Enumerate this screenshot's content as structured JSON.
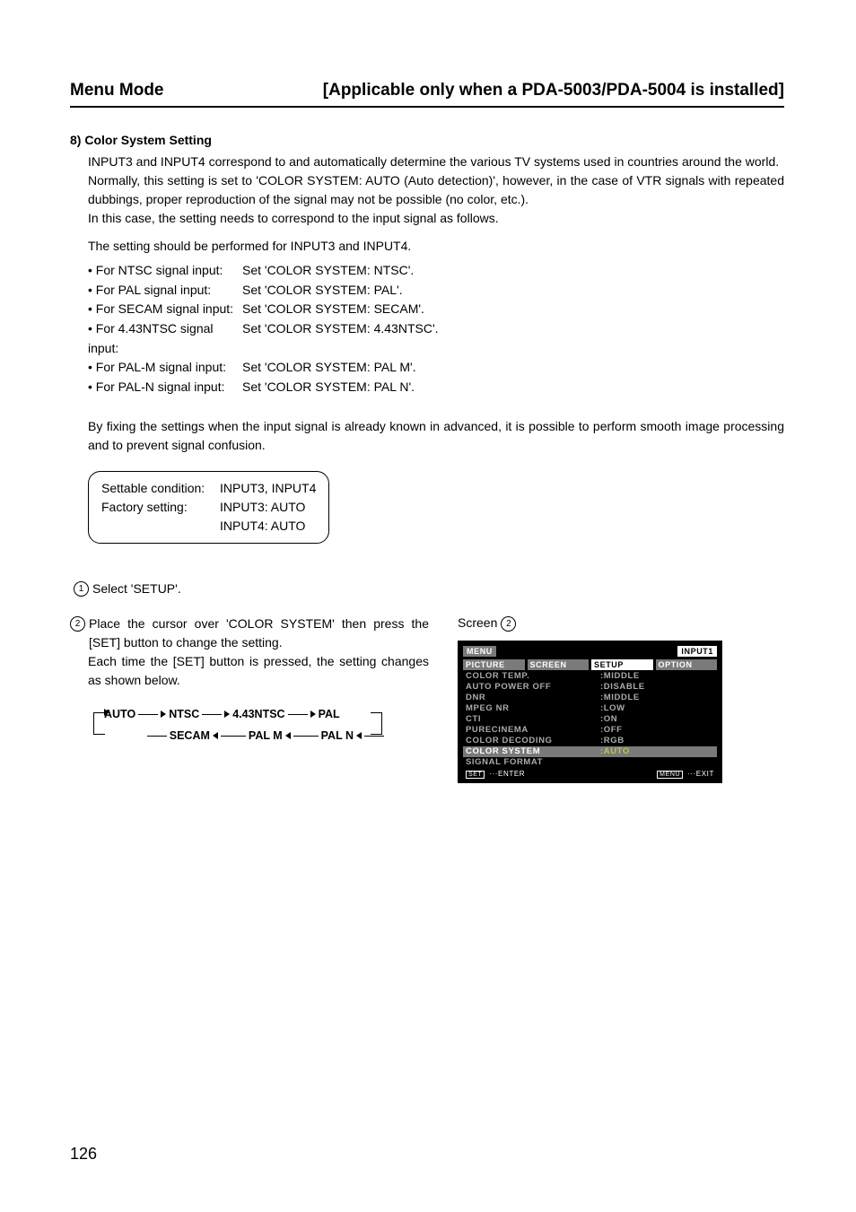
{
  "header": {
    "left": "Menu Mode",
    "right": "[Applicable only when a PDA-5003/PDA-5004 is installed]"
  },
  "section": {
    "title": "8) Color System Setting",
    "p1": "INPUT3 and INPUT4 correspond to and automatically determine the various TV systems used in countries around the world.",
    "p2": " Normally, this setting is set to 'COLOR SYSTEM: AUTO (Auto detection)', however, in the case of VTR signals with repeated dubbings, proper reproduction of the signal may not be possible (no color, etc.).",
    "p3": "In this case, the setting needs to correspond to the input signal as follows.",
    "p4": "The setting should be performed for INPUT3 and INPUT4.",
    "bullets": [
      {
        "label": "• For NTSC signal input:",
        "value": "Set 'COLOR SYSTEM: NTSC'."
      },
      {
        "label": "• For PAL signal input:",
        "value": "Set 'COLOR SYSTEM: PAL'."
      },
      {
        "label": "• For SECAM signal input:",
        "value": "Set 'COLOR SYSTEM: SECAM'."
      },
      {
        "label": "• For 4.43NTSC signal input:",
        "value": "Set 'COLOR SYSTEM: 4.43NTSC'."
      },
      {
        "label": "• For PAL-M signal input:",
        "value": "Set 'COLOR SYSTEM: PAL M'."
      },
      {
        "label": "• For PAL-N signal input:",
        "value": "Set 'COLOR SYSTEM: PAL N'."
      }
    ],
    "p5": "By fixing the settings when the input signal is already known in advanced, it is possible to perform smooth image processing and to prevent signal confusion."
  },
  "settings_box": {
    "rows": [
      {
        "label": "Settable condition:",
        "value": "INPUT3, INPUT4"
      },
      {
        "label": "Factory setting:",
        "value": "INPUT3: AUTO"
      },
      {
        "label": "",
        "value": "INPUT4: AUTO"
      }
    ]
  },
  "steps": {
    "s1_num": "1",
    "s1": "Select 'SETUP'.",
    "s2_num": "2",
    "s2a": "Place the cursor over 'COLOR SYSTEM' then press the [SET] button to change the setting.",
    "s2b": "Each time the [SET] button is pressed, the setting changes as shown below."
  },
  "cycle": {
    "auto": "AUTO",
    "ntsc": "NTSC",
    "ntsc443": "4.43NTSC",
    "pal": "PAL",
    "secam": "SECAM",
    "palm": "PAL M",
    "paln": "PAL N"
  },
  "screen": {
    "label": "Screen",
    "label_num": "2",
    "menu": "MENU",
    "input": "INPUT1",
    "tabs": [
      "PICTURE",
      "SCREEN",
      "SETUP",
      "OPTION"
    ],
    "active_tab_index": 2,
    "items": [
      {
        "label": "COLOR TEMP.",
        "value": ":MIDDLE"
      },
      {
        "label": "AUTO POWER OFF",
        "value": ":DISABLE"
      },
      {
        "label": "DNR",
        "value": ":MIDDLE"
      },
      {
        "label": "MPEG NR",
        "value": ":LOW"
      },
      {
        "label": "CTI",
        "value": ":ON"
      },
      {
        "label": "PURECINEMA",
        "value": ":OFF"
      },
      {
        "label": "COLOR DECODING",
        "value": ":RGB"
      },
      {
        "label": "COLOR SYSTEM",
        "value": ":AUTO"
      },
      {
        "label": "SIGNAL FORMAT",
        "value": ""
      }
    ],
    "highlight_index": 7,
    "foot_left_btn": "SET",
    "foot_left_text": "···ENTER",
    "foot_right_btn": "MENU",
    "foot_right_text": "···EXIT"
  },
  "page_number": "126"
}
